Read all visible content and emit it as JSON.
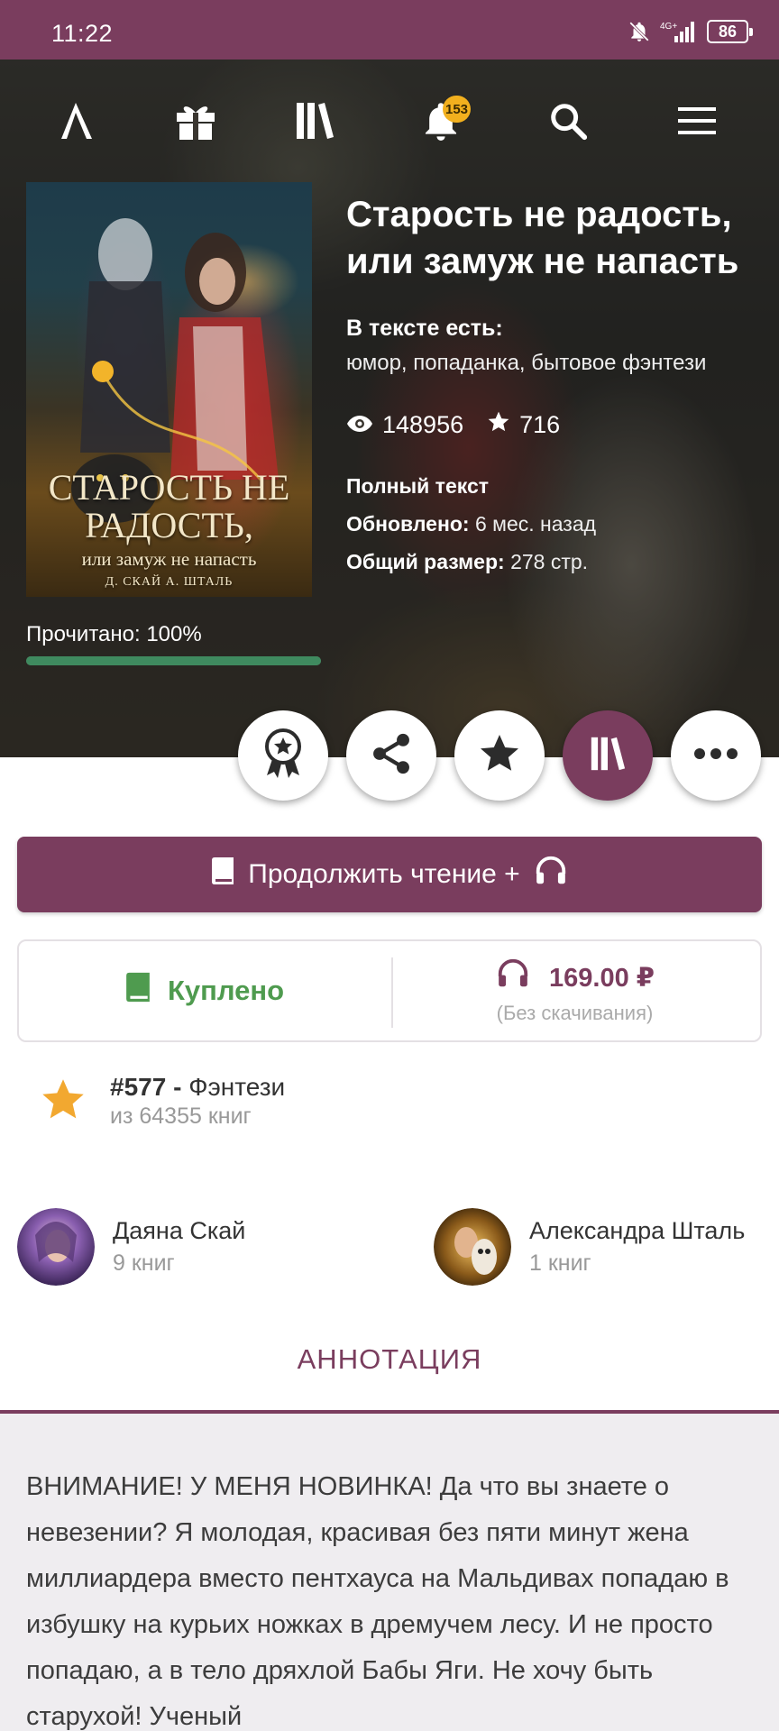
{
  "status_bar": {
    "time": "11:22",
    "network": "4G+",
    "battery": "86"
  },
  "nav": {
    "logo_icon": "logo-lambda-icon",
    "gift_icon": "gift-icon",
    "library_icon": "library-icon",
    "bell_icon": "bell-icon",
    "notifications_count": "153",
    "search_icon": "search-icon",
    "menu_icon": "hamburger-menu-icon"
  },
  "book": {
    "title": "Старость не радость, или замуж не напасть",
    "genre_heading": "В тексте есть:",
    "genres": "юмор, попаданка, бытовое фэнтези",
    "views": "148956",
    "likes": "716",
    "status": "Полный текст",
    "updated_label": "Обновлено:",
    "updated_value": "6 мес. назад",
    "size_label": "Общий размер:",
    "size_value": "278 стр.",
    "read_progress_text": "Прочитано: 100%",
    "read_progress_fraction": 1.0,
    "cover": {
      "title_line1": "СТАРОСТЬ НЕ",
      "title_line2": "РАДОСТЬ,",
      "title_line3": "или замуж не напасть",
      "authors": "Д. СКАЙ   А. ШТАЛЬ"
    }
  },
  "actions": [
    {
      "name": "award-icon"
    },
    {
      "name": "share-icon"
    },
    {
      "name": "star-icon"
    },
    {
      "name": "library-icon"
    },
    {
      "name": "more-icon"
    }
  ],
  "continue_button": {
    "label": "Продолжить чтение +",
    "book_icon": "book-icon",
    "headphones_icon": "headphones-icon"
  },
  "purchase": {
    "bought_label": "Куплено",
    "audio_price": "169.00 ₽",
    "audio_note": "(Без скачивания)"
  },
  "rank": {
    "position": "#577 -",
    "category": "Фэнтези",
    "total": "из 64355 книг"
  },
  "authors": [
    {
      "name": "Даяна Скай",
      "books": "9 книг"
    },
    {
      "name": "Александра Шталь",
      "books": "1 книг"
    }
  ],
  "annotation": {
    "tab_label": "АННОТАЦИЯ",
    "text": "ВНИМАНИЕ! У МЕНЯ НОВИНКА! Да что вы знаете о невезении? Я молодая, красивая без пяти минут жена миллиардера вместо пентхауса на Мальдивах попадаю в избушку на курьих ножках в дремучем лесу. И не просто попадаю, а в тело дряхлой Бабы Яги. Не хочу быть старухой! Ученый"
  },
  "colors": {
    "accent": "#7a3d5e",
    "success": "#4f9b4f",
    "badge": "#f2b01e",
    "star": "#f2a830"
  }
}
